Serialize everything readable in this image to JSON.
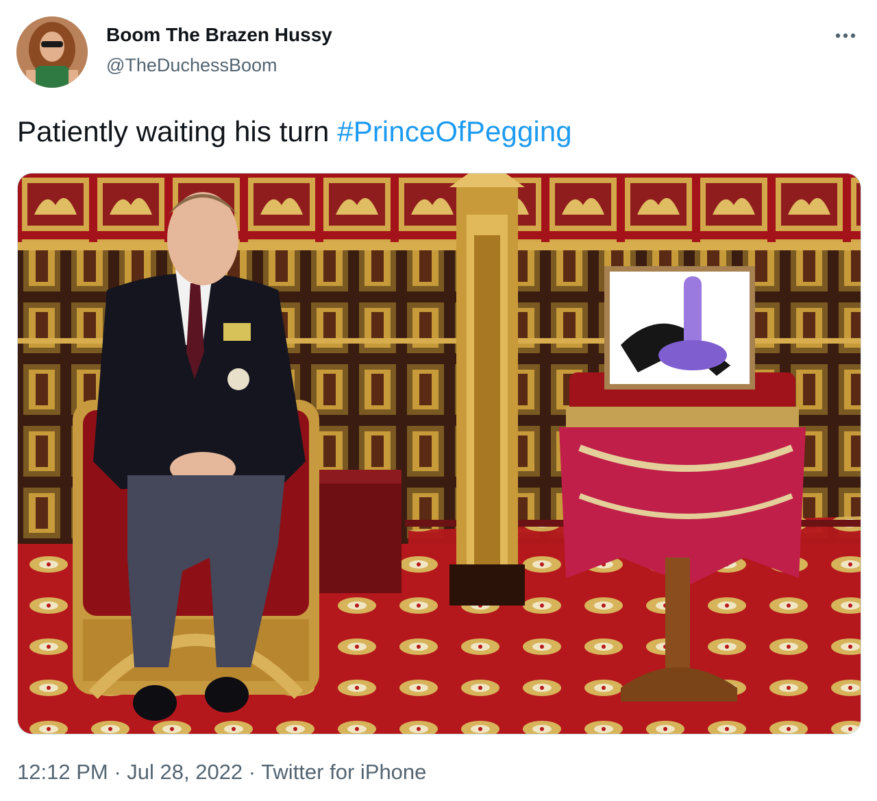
{
  "author": {
    "display_name": "Boom The Brazen Hussy",
    "handle": "@TheDuchessBoom"
  },
  "menu": {
    "icon": "more-horizontal-icon"
  },
  "tweet": {
    "text": "Patiently waiting his turn ",
    "hashtag": "#PrinceOfPegging"
  },
  "meta": {
    "time": "12:12 PM",
    "separator": " · ",
    "date": "Jul 28, 2022",
    "source": "Twitter for iPhone"
  },
  "colors": {
    "link": "#1d9bf0",
    "text": "#0f1419",
    "secondary": "#536471"
  }
}
